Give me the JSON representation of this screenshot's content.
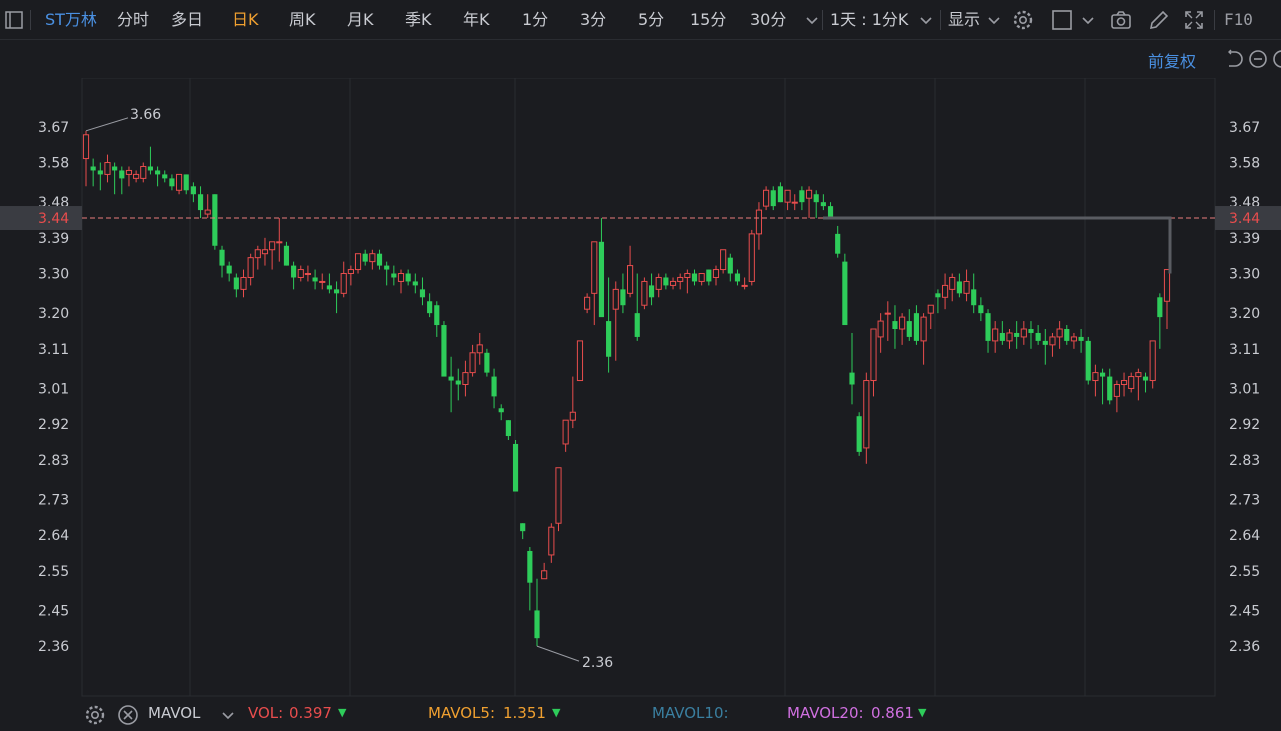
{
  "toolbar": {
    "stock_name": "ST万林",
    "periods": [
      "分时",
      "多日",
      "日K",
      "周K",
      "月K",
      "季K",
      "年K",
      "1分",
      "3分",
      "5分",
      "15分",
      "30分"
    ],
    "active_period": "日K",
    "range_label": "1天 : 1分K",
    "display_label": "显示",
    "f10_label": "F10"
  },
  "adjust_label": "前复权",
  "chart_data": {
    "type": "candlestick",
    "y_ticks": [
      "3.67",
      "3.58",
      "3.48",
      "3.39",
      "3.30",
      "3.20",
      "3.11",
      "3.01",
      "2.92",
      "2.83",
      "2.73",
      "2.64",
      "2.55",
      "2.45",
      "2.36"
    ],
    "ylim": [
      2.33,
      3.71
    ],
    "current_price": "3.44",
    "max_label": "3.66",
    "min_label": "2.36",
    "colors": {
      "up": "#e84d4d",
      "down": "#2ecc5a",
      "ref": "#e87c7c"
    },
    "candles": [
      [
        3.59,
        3.66,
        3.52,
        3.65
      ],
      [
        3.57,
        3.59,
        3.52,
        3.56
      ],
      [
        3.56,
        3.58,
        3.51,
        3.55
      ],
      [
        3.55,
        3.6,
        3.53,
        3.58
      ],
      [
        3.57,
        3.58,
        3.5,
        3.56
      ],
      [
        3.56,
        3.57,
        3.5,
        3.54
      ],
      [
        3.55,
        3.57,
        3.52,
        3.56
      ],
      [
        3.54,
        3.56,
        3.53,
        3.55
      ],
      [
        3.54,
        3.58,
        3.53,
        3.57
      ],
      [
        3.57,
        3.62,
        3.55,
        3.56
      ],
      [
        3.56,
        3.57,
        3.52,
        3.55
      ],
      [
        3.55,
        3.56,
        3.53,
        3.54
      ],
      [
        3.54,
        3.55,
        3.51,
        3.52
      ],
      [
        3.51,
        3.55,
        3.5,
        3.55
      ],
      [
        3.55,
        3.55,
        3.5,
        3.51
      ],
      [
        3.52,
        3.53,
        3.48,
        3.5
      ],
      [
        3.5,
        3.52,
        3.44,
        3.46
      ],
      [
        3.45,
        3.5,
        3.44,
        3.46
      ],
      [
        3.5,
        3.5,
        3.36,
        3.37
      ],
      [
        3.36,
        3.37,
        3.29,
        3.32
      ],
      [
        3.32,
        3.33,
        3.28,
        3.3
      ],
      [
        3.29,
        3.3,
        3.24,
        3.26
      ],
      [
        3.26,
        3.31,
        3.24,
        3.29
      ],
      [
        3.29,
        3.35,
        3.27,
        3.34
      ],
      [
        3.34,
        3.37,
        3.31,
        3.36
      ],
      [
        3.35,
        3.39,
        3.32,
        3.36
      ],
      [
        3.36,
        3.38,
        3.31,
        3.38
      ],
      [
        3.38,
        3.44,
        3.33,
        3.38
      ],
      [
        3.37,
        3.38,
        3.32,
        3.32
      ],
      [
        3.32,
        3.33,
        3.26,
        3.29
      ],
      [
        3.29,
        3.32,
        3.28,
        3.31
      ],
      [
        3.3,
        3.32,
        3.28,
        3.3
      ],
      [
        3.29,
        3.31,
        3.26,
        3.28
      ],
      [
        3.28,
        3.3,
        3.26,
        3.28
      ],
      [
        3.27,
        3.3,
        3.25,
        3.26
      ],
      [
        3.26,
        3.28,
        3.2,
        3.25
      ],
      [
        3.25,
        3.33,
        3.24,
        3.3
      ],
      [
        3.3,
        3.32,
        3.27,
        3.31
      ],
      [
        3.31,
        3.35,
        3.3,
        3.35
      ],
      [
        3.35,
        3.36,
        3.32,
        3.33
      ],
      [
        3.33,
        3.36,
        3.31,
        3.35
      ],
      [
        3.35,
        3.36,
        3.31,
        3.32
      ],
      [
        3.32,
        3.33,
        3.27,
        3.31
      ],
      [
        3.3,
        3.32,
        3.27,
        3.29
      ],
      [
        3.28,
        3.31,
        3.25,
        3.3
      ],
      [
        3.3,
        3.31,
        3.27,
        3.28
      ],
      [
        3.28,
        3.3,
        3.25,
        3.27
      ],
      [
        3.26,
        3.29,
        3.22,
        3.24
      ],
      [
        3.23,
        3.25,
        3.19,
        3.2
      ],
      [
        3.22,
        3.23,
        3.14,
        3.17
      ],
      [
        3.17,
        3.18,
        3.07,
        3.04
      ],
      [
        3.04,
        3.09,
        2.95,
        3.03
      ],
      [
        3.03,
        3.06,
        2.98,
        3.02
      ],
      [
        3.02,
        3.08,
        2.99,
        3.05
      ],
      [
        3.05,
        3.12,
        3.04,
        3.1
      ],
      [
        3.1,
        3.15,
        3.07,
        3.12
      ],
      [
        3.1,
        3.11,
        3.04,
        3.05
      ],
      [
        3.04,
        3.06,
        2.96,
        2.99
      ],
      [
        2.96,
        2.97,
        2.93,
        2.95
      ],
      [
        2.93,
        2.93,
        2.88,
        2.89
      ],
      [
        2.87,
        2.88,
        2.76,
        2.75
      ],
      [
        2.67,
        2.67,
        2.63,
        2.65
      ],
      [
        2.6,
        2.61,
        2.45,
        2.52
      ],
      [
        2.45,
        2.53,
        2.36,
        2.38
      ],
      [
        2.53,
        2.57,
        2.53,
        2.55
      ],
      [
        2.59,
        2.67,
        2.57,
        2.66
      ],
      [
        2.67,
        2.81,
        2.65,
        2.81
      ],
      [
        2.87,
        2.92,
        2.85,
        2.93
      ],
      [
        2.93,
        3.04,
        2.91,
        2.95
      ],
      [
        3.03,
        3.13,
        3.03,
        3.13
      ],
      [
        3.21,
        3.25,
        3.2,
        3.24
      ],
      [
        3.25,
        3.38,
        3.17,
        3.38
      ],
      [
        3.38,
        3.44,
        3.3,
        3.19
      ],
      [
        3.18,
        3.29,
        3.05,
        3.09
      ],
      [
        3.21,
        3.28,
        3.08,
        3.26
      ],
      [
        3.26,
        3.3,
        3.2,
        3.22
      ],
      [
        3.25,
        3.37,
        3.24,
        3.32
      ],
      [
        3.2,
        3.3,
        3.13,
        3.14
      ],
      [
        3.22,
        3.29,
        3.21,
        3.28
      ],
      [
        3.27,
        3.3,
        3.22,
        3.24
      ],
      [
        3.26,
        3.3,
        3.24,
        3.29
      ],
      [
        3.29,
        3.3,
        3.26,
        3.27
      ],
      [
        3.27,
        3.29,
        3.26,
        3.28
      ],
      [
        3.28,
        3.3,
        3.26,
        3.29
      ],
      [
        3.29,
        3.31,
        3.25,
        3.3
      ],
      [
        3.3,
        3.31,
        3.27,
        3.28
      ],
      [
        3.28,
        3.3,
        3.27,
        3.3
      ],
      [
        3.31,
        3.31,
        3.27,
        3.28
      ],
      [
        3.29,
        3.32,
        3.27,
        3.31
      ],
      [
        3.31,
        3.36,
        3.3,
        3.36
      ],
      [
        3.34,
        3.35,
        3.28,
        3.3
      ],
      [
        3.3,
        3.31,
        3.27,
        3.28
      ],
      [
        3.27,
        3.29,
        3.26,
        3.27
      ],
      [
        3.28,
        3.41,
        3.27,
        3.4
      ],
      [
        3.4,
        3.48,
        3.36,
        3.46
      ],
      [
        3.47,
        3.52,
        3.46,
        3.51
      ],
      [
        3.51,
        3.52,
        3.46,
        3.47
      ],
      [
        3.52,
        3.53,
        3.48,
        3.48
      ],
      [
        3.48,
        3.51,
        3.46,
        3.51
      ],
      [
        3.48,
        3.5,
        3.46,
        3.48
      ],
      [
        3.51,
        3.52,
        3.46,
        3.48
      ],
      [
        3.49,
        3.52,
        3.44,
        3.51
      ],
      [
        3.5,
        3.51,
        3.44,
        3.48
      ],
      [
        3.48,
        3.5,
        3.46,
        3.47
      ],
      [
        3.47,
        3.48,
        3.44,
        3.44
      ],
      [
        3.4,
        3.42,
        3.34,
        3.35
      ],
      [
        3.33,
        3.35,
        3.2,
        3.17
      ],
      [
        3.05,
        3.15,
        2.97,
        3.02
      ],
      [
        2.94,
        2.95,
        2.84,
        2.85
      ],
      [
        2.86,
        3.05,
        2.82,
        3.03
      ],
      [
        3.03,
        3.14,
        2.99,
        3.16
      ],
      [
        3.14,
        3.2,
        3.1,
        3.18
      ],
      [
        3.2,
        3.23,
        3.13,
        3.2
      ],
      [
        3.18,
        3.22,
        3.11,
        3.16
      ],
      [
        3.16,
        3.2,
        3.12,
        3.19
      ],
      [
        3.18,
        3.21,
        3.13,
        3.14
      ],
      [
        3.2,
        3.22,
        3.12,
        3.13
      ],
      [
        3.13,
        3.2,
        3.07,
        3.19
      ],
      [
        3.2,
        3.22,
        3.16,
        3.22
      ],
      [
        3.25,
        3.26,
        3.2,
        3.24
      ],
      [
        3.24,
        3.3,
        3.21,
        3.27
      ],
      [
        3.26,
        3.3,
        3.23,
        3.29
      ],
      [
        3.28,
        3.3,
        3.24,
        3.25
      ],
      [
        3.25,
        3.31,
        3.23,
        3.28
      ],
      [
        3.26,
        3.3,
        3.2,
        3.22
      ],
      [
        3.22,
        3.24,
        3.18,
        3.2
      ],
      [
        3.2,
        3.21,
        3.1,
        3.13
      ],
      [
        3.13,
        3.18,
        3.1,
        3.16
      ],
      [
        3.15,
        3.18,
        3.12,
        3.13
      ],
      [
        3.13,
        3.16,
        3.11,
        3.15
      ],
      [
        3.15,
        3.18,
        3.11,
        3.14
      ],
      [
        3.14,
        3.18,
        3.12,
        3.16
      ],
      [
        3.16,
        3.18,
        3.11,
        3.15
      ],
      [
        3.15,
        3.17,
        3.12,
        3.13
      ],
      [
        3.13,
        3.16,
        3.07,
        3.12
      ],
      [
        3.12,
        3.15,
        3.09,
        3.14
      ],
      [
        3.14,
        3.18,
        3.11,
        3.16
      ],
      [
        3.16,
        3.17,
        3.12,
        3.13
      ],
      [
        3.13,
        3.15,
        3.11,
        3.14
      ],
      [
        3.14,
        3.16,
        3.1,
        3.13
      ],
      [
        3.13,
        3.14,
        3.02,
        3.03
      ],
      [
        3.03,
        3.07,
        2.99,
        3.05
      ],
      [
        3.05,
        3.06,
        2.97,
        3.04
      ],
      [
        3.04,
        3.06,
        2.97,
        2.98
      ],
      [
        2.99,
        3.03,
        2.95,
        3.02
      ],
      [
        3.02,
        3.05,
        2.99,
        3.03
      ],
      [
        3.01,
        3.05,
        3.0,
        3.04
      ],
      [
        3.04,
        3.06,
        2.98,
        3.05
      ],
      [
        3.04,
        3.05,
        3.0,
        3.03
      ],
      [
        3.03,
        3.13,
        3.01,
        3.13
      ],
      [
        3.24,
        3.25,
        3.11,
        3.19
      ],
      [
        3.23,
        3.29,
        3.16,
        3.31
      ]
    ]
  },
  "indicators": {
    "name": "MAVOL",
    "vol_label": "VOL:",
    "vol_value": "0.397",
    "mavol5_label": "MAVOL5:",
    "mavol5_value": "1.351",
    "mavol10_label": "MAVOL10:",
    "mavol20_label": "MAVOL20:",
    "mavol20_value": "0.861"
  }
}
